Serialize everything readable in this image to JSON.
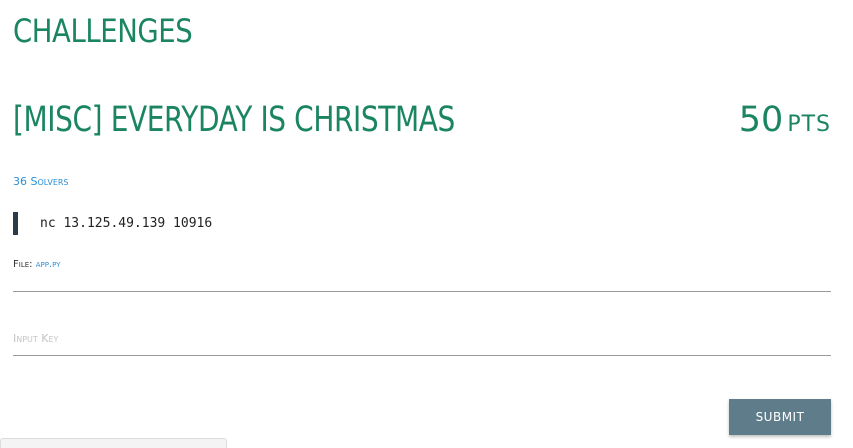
{
  "page": {
    "heading": "CHALLENGES"
  },
  "challenge": {
    "title": "[MISC] EVERYDAY IS CHRISTMAS",
    "points_value": "50",
    "points_unit": "PTS",
    "solvers": "36 Solvers",
    "command": "nc 13.125.49.139 10916",
    "file_label": "File:",
    "file_name": "app.py"
  },
  "form": {
    "key_placeholder": "Input Key",
    "key_value": "",
    "submit_label": "SUBMIT"
  },
  "colors": {
    "accent_green": "#1b8561",
    "link_blue": "#2c8fd6",
    "button_bg": "#5f7c8b",
    "quote_bar": "#2d3b48"
  }
}
